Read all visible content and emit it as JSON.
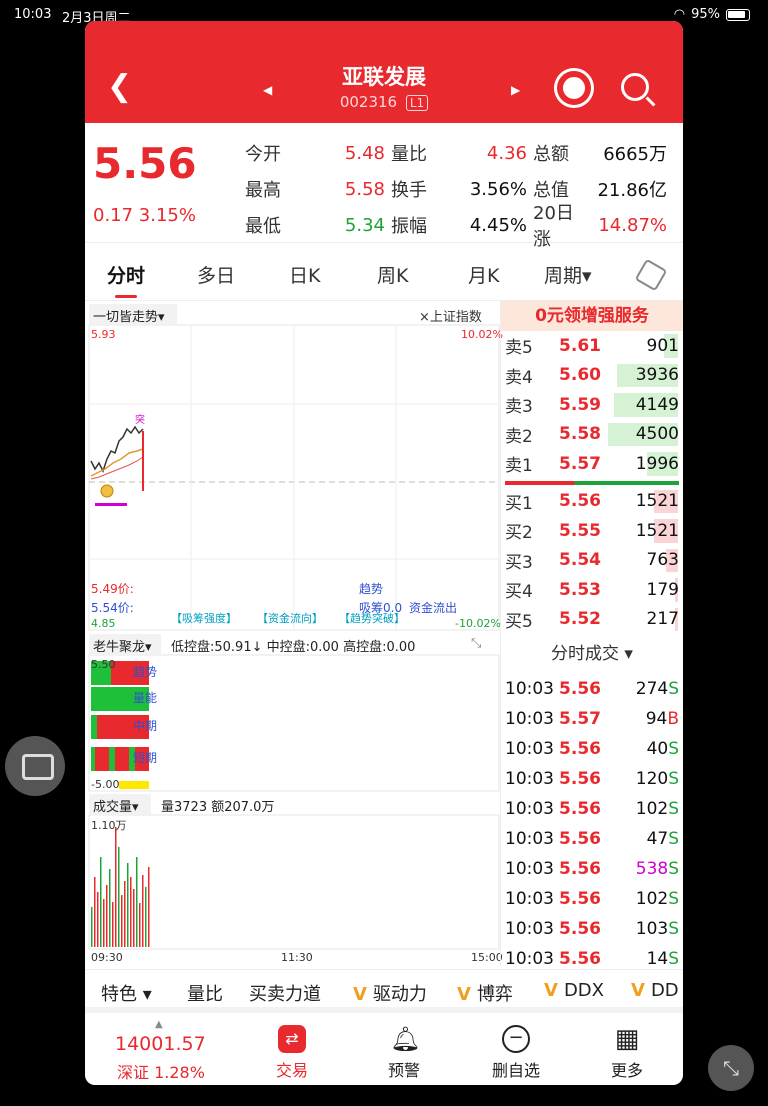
{
  "status": {
    "time": "10:03",
    "date": "2月3日周二",
    "battery": "95%"
  },
  "header": {
    "title": "亚联发展",
    "code": "002316",
    "level": "L1"
  },
  "quote": {
    "price": "5.56",
    "change": "0.17 3.15%",
    "rows": [
      {
        "l1": "今开",
        "v1": "5.48",
        "l2": "量比",
        "v2": "4.36",
        "l3": "总额",
        "v3": "6665万"
      },
      {
        "l1": "最高",
        "v1": "5.58",
        "l2": "换手",
        "v2": "3.56%",
        "l3": "总值",
        "v3": "21.86亿"
      },
      {
        "l1": "最低",
        "v1": "5.34",
        "l2": "振幅",
        "v2": "4.45%",
        "l3": "20日涨",
        "v3": "14.87%"
      }
    ]
  },
  "tabs": [
    "分时",
    "多日",
    "日K",
    "周K",
    "月K",
    "周期▾"
  ],
  "chart": {
    "indicator_name": "一切皆走势▾",
    "compare": "×上证指数",
    "y_top": "5.93",
    "y_bottom": "4.85",
    "pct_top": "10.02%",
    "pct_bottom": "-10.02%",
    "overlay_labels": [
      "【吸筹强度】",
      "【资金流向】",
      "【趋势突破】"
    ],
    "lines_text": [
      "5.49价:",
      "5.54价:",
      "趋势",
      "吸筹0.0",
      "资金流出"
    ],
    "sub1_name": "老牛聚龙▾",
    "sub1_info": "低控盘:50.91↓ 中控盘:0.00 高控盘:0.00",
    "sub1_top": "5.50",
    "sub1_bottom": "-5.00",
    "sub1_labels": [
      "趋势",
      "量能",
      "中期",
      "短期"
    ],
    "sub2_name": "成交量▾",
    "sub2_info": "量3723 额207.0万",
    "sub2_top": "1.10万",
    "time_axis": [
      "09:30",
      "11:30",
      "15:00"
    ]
  },
  "orderbook": {
    "promo": "0元领增强服务",
    "sell": [
      {
        "label": "卖5",
        "price": "5.61",
        "vol": "901",
        "fill": 0.2
      },
      {
        "label": "卖4",
        "price": "5.60",
        "vol": "3936",
        "fill": 0.87
      },
      {
        "label": "卖3",
        "price": "5.59",
        "vol": "4149",
        "fill": 0.92
      },
      {
        "label": "卖2",
        "price": "5.58",
        "vol": "4500",
        "fill": 1.0
      },
      {
        "label": "卖1",
        "price": "5.57",
        "vol": "1996",
        "fill": 0.44
      }
    ],
    "buy": [
      {
        "label": "买1",
        "price": "5.56",
        "vol": "1521",
        "fill": 0.34
      },
      {
        "label": "买2",
        "price": "5.55",
        "vol": "1521",
        "fill": 0.34
      },
      {
        "label": "买3",
        "price": "5.54",
        "vol": "763",
        "fill": 0.17
      },
      {
        "label": "买4",
        "price": "5.53",
        "vol": "179",
        "fill": 0.04
      },
      {
        "label": "买5",
        "price": "5.52",
        "vol": "217",
        "fill": 0.05
      }
    ],
    "ticks_title": "分时成交 ▾",
    "ticks": [
      {
        "t": "10:03",
        "p": "5.56",
        "v": "274",
        "s": "S"
      },
      {
        "t": "10:03",
        "p": "5.57",
        "v": "94",
        "s": "B"
      },
      {
        "t": "10:03",
        "p": "5.56",
        "v": "40",
        "s": "S"
      },
      {
        "t": "10:03",
        "p": "5.56",
        "v": "120",
        "s": "S"
      },
      {
        "t": "10:03",
        "p": "5.56",
        "v": "102",
        "s": "S"
      },
      {
        "t": "10:03",
        "p": "5.56",
        "v": "47",
        "s": "S"
      },
      {
        "t": "10:03",
        "p": "5.56",
        "v": "538",
        "s": "S"
      },
      {
        "t": "10:03",
        "p": "5.56",
        "v": "102",
        "s": "S"
      },
      {
        "t": "10:03",
        "p": "5.56",
        "v": "103",
        "s": "S"
      },
      {
        "t": "10:03",
        "p": "5.56",
        "v": "14",
        "s": "S"
      }
    ]
  },
  "tools": [
    "特色 ▾",
    "量比",
    "买卖力道",
    "驱动力",
    "博弈",
    "DDX",
    "DD"
  ],
  "nav": {
    "index_value": "14001.57",
    "index_name": "深证 1.28%",
    "items": [
      "交易",
      "预警",
      "删自选",
      "更多"
    ]
  },
  "colors": {
    "up": "#e8292d",
    "down": "#1ea33a",
    "brand": "#e8292d"
  }
}
